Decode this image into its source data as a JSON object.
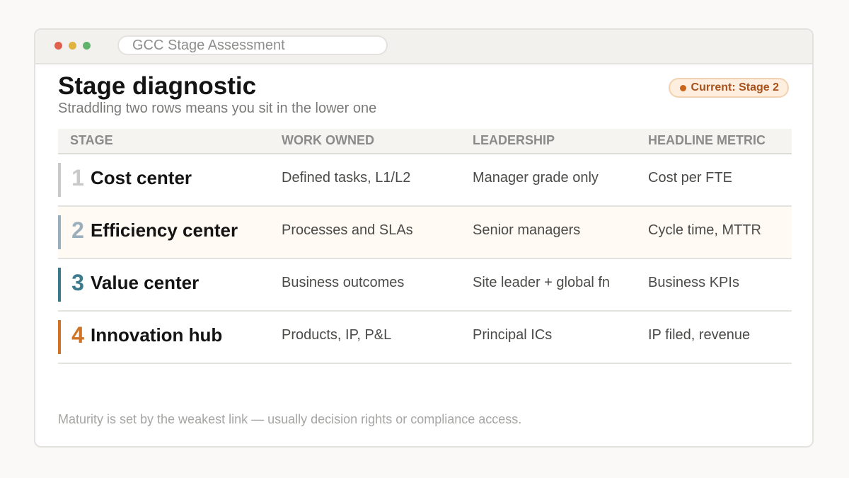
{
  "window": {
    "address": "GCC Stage Assessment",
    "dots": {
      "red": "#e0614e",
      "yellow": "#e0b33e",
      "green": "#5fb36b"
    }
  },
  "header": {
    "title": "Stage diagnostic",
    "subtitle": "Straddling two rows means you sit in the lower one",
    "badge": {
      "label": "Current: Stage 2",
      "color": "#c8651b",
      "text_color": "#a8521a"
    }
  },
  "table": {
    "columns": [
      "STAGE",
      "WORK OWNED",
      "LEADERSHIP",
      "HEADLINE METRIC"
    ],
    "rows": [
      {
        "num": "1",
        "name": "Cost center",
        "work": "Defined tasks, L1/L2",
        "leadership": "Manager grade only",
        "metric": "Cost per FTE",
        "accent": "#c9c9c7",
        "highlight": false
      },
      {
        "num": "2",
        "name": "Efficiency center",
        "work": "Processes and SLAs",
        "leadership": "Senior managers",
        "metric": "Cycle time, MTTR",
        "accent": "#9aafbb",
        "highlight": true
      },
      {
        "num": "3",
        "name": "Value center",
        "work": "Business outcomes",
        "leadership": "Site leader + global fn",
        "metric": "Business KPIs",
        "accent": "#3b7a8a",
        "highlight": false
      },
      {
        "num": "4",
        "name": "Innovation hub",
        "work": "Products, IP, P&L",
        "leadership": "Principal ICs",
        "metric": "IP filed, revenue",
        "accent": "#cf7326",
        "highlight": false
      }
    ]
  },
  "footnote": "Maturity is set by the weakest link — usually decision rights or compliance access."
}
